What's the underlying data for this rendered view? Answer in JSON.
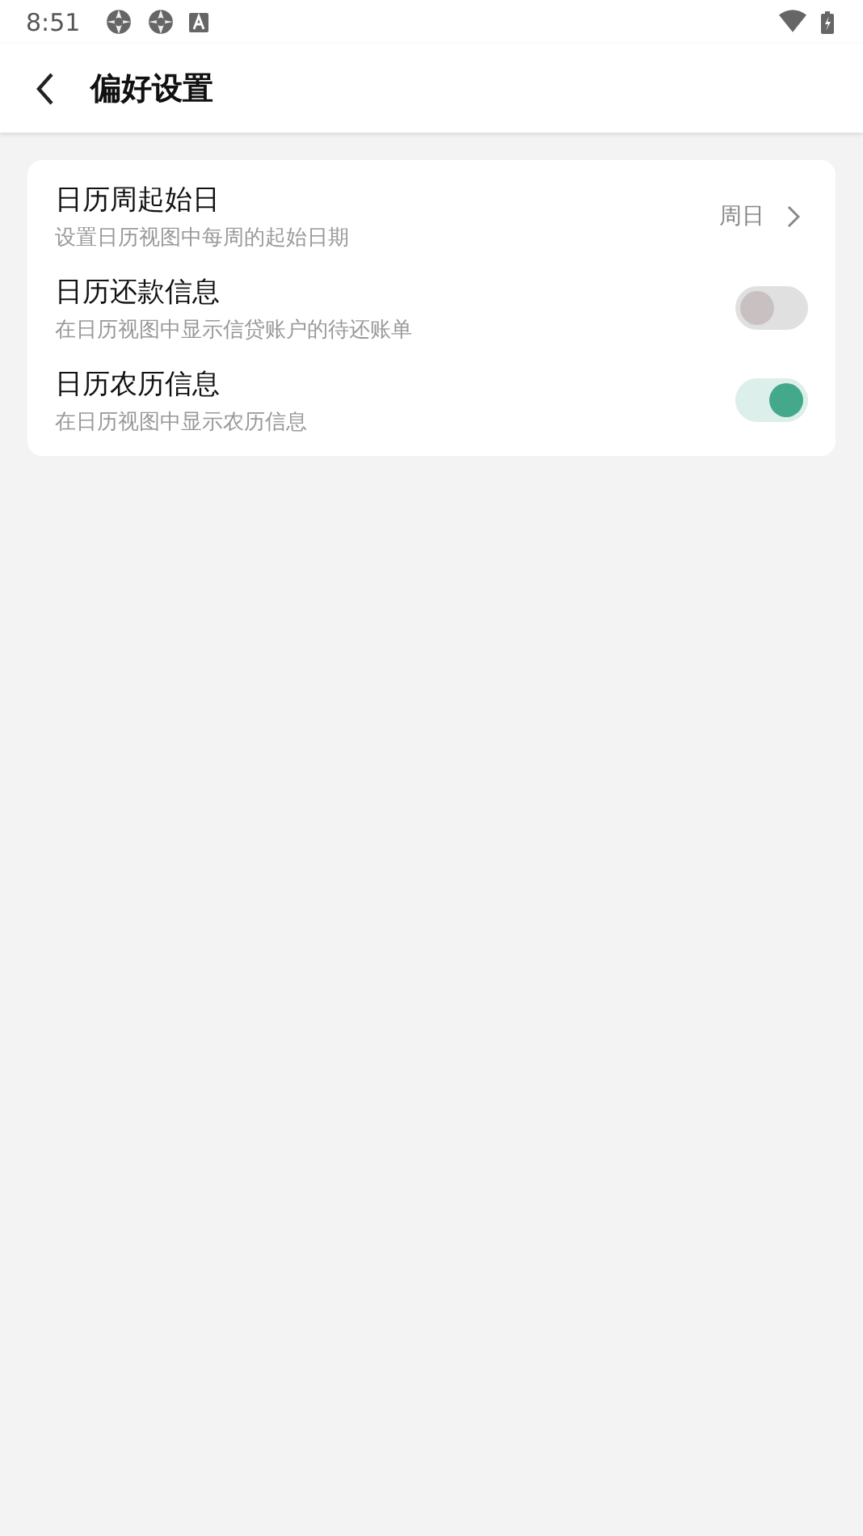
{
  "status_bar": {
    "time": "8:51"
  },
  "header": {
    "title": "偏好设置"
  },
  "settings": [
    {
      "kind": "link",
      "title": "日历周起始日",
      "description": "设置日历视图中每周的起始日期",
      "value": "周日"
    },
    {
      "kind": "toggle",
      "title": "日历还款信息",
      "description": "在日历视图中显示信贷账户的待还账单",
      "on": false
    },
    {
      "kind": "toggle",
      "title": "日历农历信息",
      "description": "在日历视图中显示农历信息",
      "on": true
    }
  ]
}
